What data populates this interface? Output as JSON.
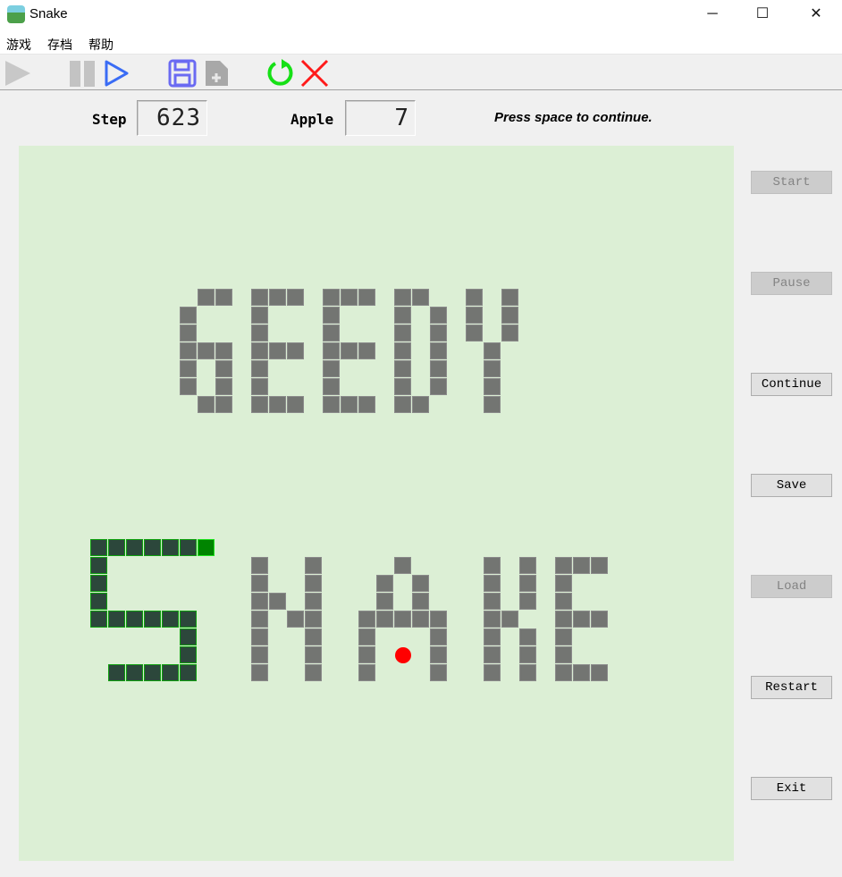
{
  "window": {
    "title": "Snake",
    "minimize": "─",
    "maximize": "☐",
    "close": "✕"
  },
  "menu": [
    "游戏",
    "存档",
    "帮助"
  ],
  "toolbar": [
    "play-icon",
    "pause-icon",
    "continue-icon",
    "save-icon",
    "load-icon",
    "restart-icon",
    "exit-icon"
  ],
  "stats": {
    "step_label": "Step",
    "step_value": "623",
    "apple_label": "Apple",
    "apple_value": "7"
  },
  "status": "Press space to continue.",
  "colors": {
    "board": "#dcefd5",
    "wall": "#737572",
    "snake_body": "#2c473b",
    "snake_head": "#008400",
    "apple": "#ff0000"
  },
  "buttons": [
    {
      "label": "Start",
      "enabled": false
    },
    {
      "label": "Pause",
      "enabled": false
    },
    {
      "label": "Continue",
      "enabled": true
    },
    {
      "label": "Save",
      "enabled": true
    },
    {
      "label": "Load",
      "enabled": false
    },
    {
      "label": "Restart",
      "enabled": true
    },
    {
      "label": "Exit",
      "enabled": true
    }
  ],
  "board": {
    "grid_size": 40,
    "walls": [
      [
        10,
        8
      ],
      [
        11,
        8
      ],
      [
        9,
        9
      ],
      [
        9,
        10
      ],
      [
        9,
        11
      ],
      [
        10,
        11
      ],
      [
        11,
        11
      ],
      [
        9,
        12
      ],
      [
        11,
        12
      ],
      [
        9,
        13
      ],
      [
        11,
        13
      ],
      [
        10,
        14
      ],
      [
        11,
        14
      ],
      [
        13,
        8
      ],
      [
        14,
        8
      ],
      [
        15,
        8
      ],
      [
        13,
        9
      ],
      [
        13,
        10
      ],
      [
        13,
        11
      ],
      [
        14,
        11
      ],
      [
        15,
        11
      ],
      [
        13,
        12
      ],
      [
        13,
        13
      ],
      [
        13,
        14
      ],
      [
        14,
        14
      ],
      [
        15,
        14
      ],
      [
        17,
        8
      ],
      [
        18,
        8
      ],
      [
        19,
        8
      ],
      [
        17,
        9
      ],
      [
        17,
        10
      ],
      [
        17,
        11
      ],
      [
        18,
        11
      ],
      [
        19,
        11
      ],
      [
        17,
        12
      ],
      [
        17,
        13
      ],
      [
        17,
        14
      ],
      [
        18,
        14
      ],
      [
        19,
        14
      ],
      [
        21,
        8
      ],
      [
        22,
        8
      ],
      [
        21,
        9
      ],
      [
        21,
        10
      ],
      [
        21,
        11
      ],
      [
        21,
        12
      ],
      [
        21,
        13
      ],
      [
        23,
        9
      ],
      [
        23,
        10
      ],
      [
        23,
        11
      ],
      [
        23,
        12
      ],
      [
        23,
        13
      ],
      [
        21,
        14
      ],
      [
        22,
        14
      ],
      [
        25,
        8
      ],
      [
        25,
        9
      ],
      [
        25,
        10
      ],
      [
        27,
        8
      ],
      [
        27,
        9
      ],
      [
        27,
        10
      ],
      [
        26,
        11
      ],
      [
        26,
        12
      ],
      [
        26,
        13
      ],
      [
        26,
        14
      ],
      [
        13,
        23
      ],
      [
        13,
        24
      ],
      [
        13,
        25
      ],
      [
        13,
        26
      ],
      [
        13,
        27
      ],
      [
        13,
        28
      ],
      [
        13,
        29
      ],
      [
        16,
        23
      ],
      [
        16,
        24
      ],
      [
        16,
        25
      ],
      [
        16,
        26
      ],
      [
        16,
        27
      ],
      [
        16,
        28
      ],
      [
        16,
        29
      ],
      [
        14,
        25
      ],
      [
        15,
        26
      ],
      [
        21,
        23
      ],
      [
        20,
        24
      ],
      [
        22,
        24
      ],
      [
        20,
        25
      ],
      [
        22,
        25
      ],
      [
        19,
        26
      ],
      [
        20,
        26
      ],
      [
        21,
        26
      ],
      [
        22,
        26
      ],
      [
        23,
        26
      ],
      [
        19,
        27
      ],
      [
        19,
        28
      ],
      [
        19,
        29
      ],
      [
        23,
        27
      ],
      [
        23,
        28
      ],
      [
        23,
        29
      ],
      [
        26,
        23
      ],
      [
        26,
        24
      ],
      [
        26,
        25
      ],
      [
        26,
        26
      ],
      [
        26,
        27
      ],
      [
        26,
        28
      ],
      [
        26,
        29
      ],
      [
        28,
        23
      ],
      [
        28,
        24
      ],
      [
        28,
        25
      ],
      [
        27,
        26
      ],
      [
        28,
        27
      ],
      [
        28,
        28
      ],
      [
        28,
        29
      ],
      [
        30,
        23
      ],
      [
        31,
        23
      ],
      [
        32,
        23
      ],
      [
        30,
        24
      ],
      [
        30,
        25
      ],
      [
        30,
        26
      ],
      [
        31,
        26
      ],
      [
        32,
        26
      ],
      [
        30,
        27
      ],
      [
        30,
        28
      ],
      [
        30,
        29
      ],
      [
        31,
        29
      ],
      [
        32,
        29
      ]
    ],
    "snake_head": [
      10,
      22
    ],
    "snake_body": [
      [
        9,
        22
      ],
      [
        8,
        22
      ],
      [
        7,
        22
      ],
      [
        6,
        22
      ],
      [
        5,
        22
      ],
      [
        4,
        22
      ],
      [
        4,
        23
      ],
      [
        4,
        24
      ],
      [
        4,
        25
      ],
      [
        4,
        26
      ],
      [
        5,
        26
      ],
      [
        6,
        26
      ],
      [
        7,
        26
      ],
      [
        8,
        26
      ],
      [
        9,
        26
      ],
      [
        9,
        27
      ],
      [
        9,
        28
      ],
      [
        9,
        29
      ],
      [
        8,
        29
      ],
      [
        7,
        29
      ],
      [
        6,
        29
      ],
      [
        5,
        29
      ]
    ],
    "apple": [
      21,
      28
    ]
  }
}
